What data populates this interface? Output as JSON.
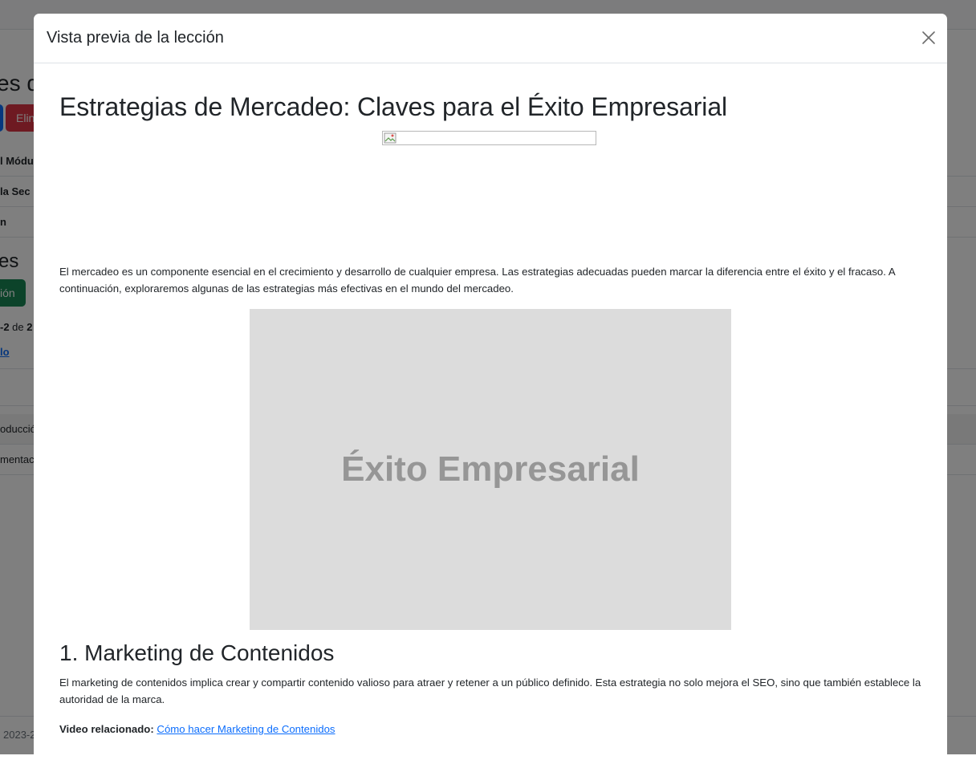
{
  "background": {
    "heading": "es d",
    "heading2": "es",
    "delete_button": "Elin",
    "add_button": "ión",
    "rows": [
      "l Módu",
      "la Sec",
      "n"
    ],
    "pagination_prefix": "-2",
    "pagination_mid": " de ",
    "pagination_total": "2",
    "link_label": "lo",
    "table_rows": [
      "oducció",
      "mentac"
    ],
    "footer": "2023-2"
  },
  "modal": {
    "title": "Vista previa de la lección",
    "close_label": "×"
  },
  "lesson": {
    "title": "Estrategias de Mercadeo: Claves para el Éxito Empresarial",
    "intro": "El mercadeo es un componente esencial en el crecimiento y desarrollo de cualquier empresa. Las estrategias adecuadas pueden marcar la diferencia entre el éxito y el fracaso. A continuación, exploraremos algunas de las estrategias más efectivas en el mundo del mercadeo.",
    "hero_image_text": "Éxito Empresarial",
    "sections": [
      {
        "heading": "1. Marketing de Contenidos",
        "text": "El marketing de contenidos implica crear y compartir contenido valioso para atraer y retener a un público definido. Esta estrategia no solo mejora el SEO, sino que también establece la autoridad de la marca.",
        "video_label": "Video relacionado:",
        "video_link": "Cómo hacer Marketing de Contenidos"
      }
    ]
  },
  "colors": {
    "link": "#0d6efd",
    "placeholder_bg": "#dcdcdc",
    "placeholder_text": "#969696",
    "backdrop": "rgba(0,0,0,0.5)"
  }
}
